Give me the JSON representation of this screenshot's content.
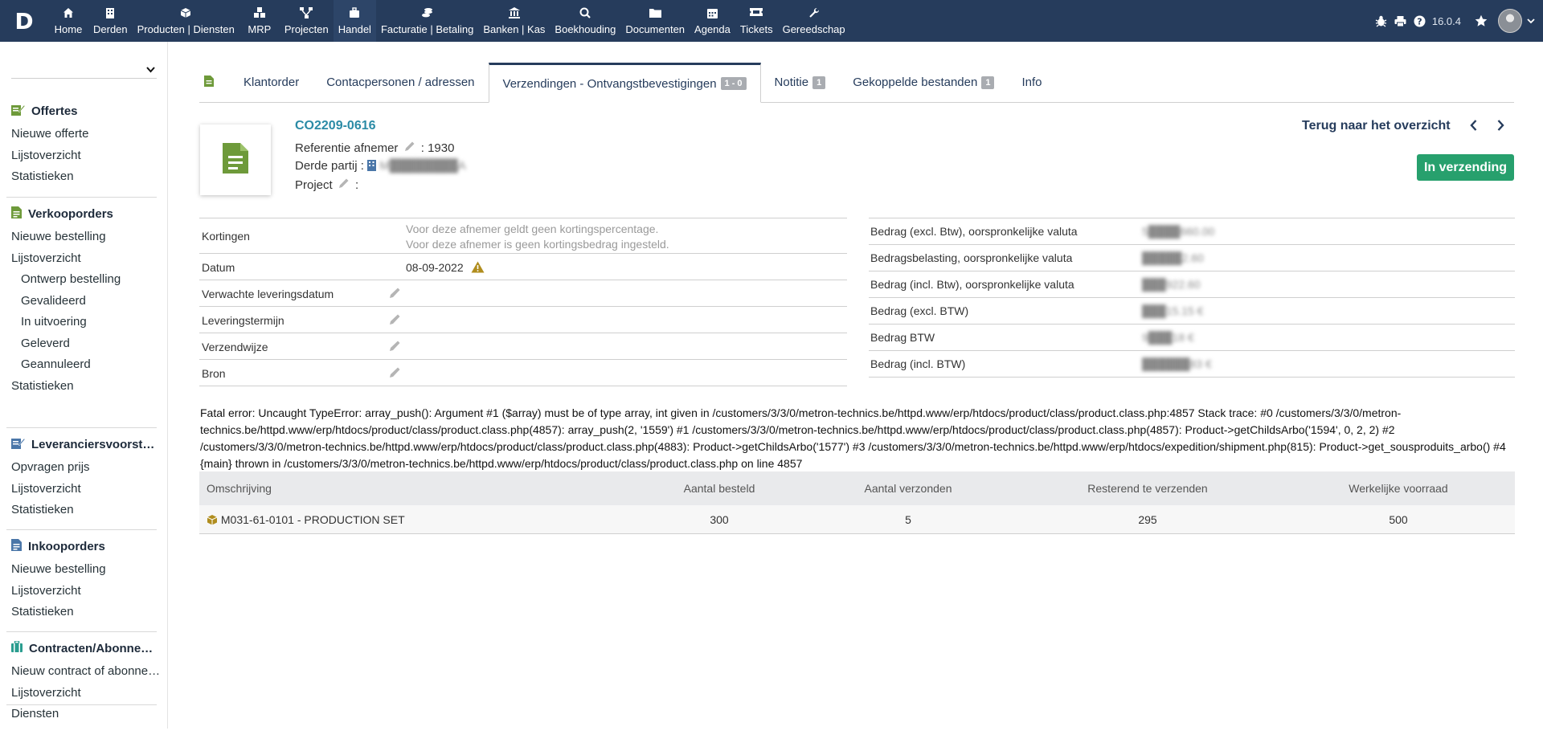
{
  "topnav": {
    "logo": "D",
    "items": [
      {
        "label": "Home",
        "icon": "home-icon"
      },
      {
        "label": "Derden",
        "icon": "building-icon"
      },
      {
        "label": "Producten | Diensten",
        "icon": "cube-icon"
      },
      {
        "label": "MRP",
        "icon": "cubes-icon"
      },
      {
        "label": "Projecten",
        "icon": "sitemap-icon"
      },
      {
        "label": "Handel",
        "icon": "briefcase-icon"
      },
      {
        "label": "Facturatie | Betaling",
        "icon": "coins-icon"
      },
      {
        "label": "Banken | Kas",
        "icon": "bank-icon"
      },
      {
        "label": "Boekhouding",
        "icon": "search-dollar-icon"
      },
      {
        "label": "Documenten",
        "icon": "folder-icon"
      },
      {
        "label": "Agenda",
        "icon": "calendar-icon"
      },
      {
        "label": "Tickets",
        "icon": "ticket-icon"
      },
      {
        "label": "Gereedschap",
        "icon": "wrench-icon"
      }
    ],
    "active": "Handel",
    "version": "16.0.4",
    "right_icons": [
      "bug-icon",
      "printer-icon",
      "help-icon",
      "star-icon",
      "avatar",
      "chevron-down-icon"
    ]
  },
  "sidebar": {
    "select_value": "",
    "sections": [
      {
        "title": "Offertes",
        "icon": "quote-icon",
        "color": "#6e9a3a",
        "links": [
          {
            "label": "Nieuwe offerte"
          },
          {
            "label": "Lijstoverzicht"
          },
          {
            "label": "Statistieken"
          }
        ]
      },
      {
        "title": "Verkooporders",
        "icon": "order-icon",
        "color": "#6e9a3a",
        "links": [
          {
            "label": "Nieuwe bestelling"
          },
          {
            "label": "Lijstoverzicht"
          },
          {
            "label": "Ontwerp bestelling",
            "sub": true
          },
          {
            "label": "Gevalideerd",
            "sub": true
          },
          {
            "label": "In uitvoering",
            "sub": true
          },
          {
            "label": "Geleverd",
            "sub": true
          },
          {
            "label": "Geannuleerd",
            "sub": true
          },
          {
            "label": "Statistieken"
          }
        ]
      },
      {
        "title": "Leveranciersvoorstellen",
        "icon": "supplier-quote-icon",
        "color": "#4a76a8",
        "links": [
          {
            "label": "Opvragen prijs"
          },
          {
            "label": "Lijstoverzicht"
          },
          {
            "label": "Statistieken"
          }
        ]
      },
      {
        "title": "Inkooporders",
        "icon": "purchase-icon",
        "color": "#4a76a8",
        "links": [
          {
            "label": "Nieuwe bestelling"
          },
          {
            "label": "Lijstoverzicht"
          },
          {
            "label": "Statistieken"
          }
        ]
      },
      {
        "title": "Contracten/Abonnementen",
        "icon": "contract-icon",
        "color": "#2a9d8f",
        "links": [
          {
            "label": "Nieuw contract of abonnement"
          },
          {
            "label": "Lijstoverzicht"
          },
          {
            "label": "Diensten"
          }
        ]
      }
    ]
  },
  "tabs": [
    {
      "label": "Klantorder"
    },
    {
      "label": "Contacpersonen / adressen"
    },
    {
      "label": "Verzendingen - Ontvangstbevestigingen",
      "badge": "1 - 0",
      "active": true
    },
    {
      "label": "Notitie",
      "badge": "1"
    },
    {
      "label": "Gekoppelde bestanden",
      "badge": "1"
    },
    {
      "label": "Info"
    }
  ],
  "header": {
    "ref": "CO2209-0616",
    "ref_afnemer_label": "Referentie afnemer",
    "ref_afnemer_value": ": 1930",
    "derde_label": "Derde partij :",
    "derde_value": "M████████A",
    "project_label": "Project",
    "project_value": ":",
    "back_label": "Terug naar het overzicht",
    "status_label": "In verzending",
    "status_color": "#27a06d"
  },
  "left_info": [
    {
      "label": "Kortingen",
      "value1": "Voor deze afnemer geldt geen kortingspercentage.",
      "value2": "Voor deze afnemer is geen kortingsbedrag ingesteld."
    },
    {
      "label": "Datum",
      "value": "08-09-2022",
      "warning": true
    },
    {
      "label": "Verwachte leveringsdatum",
      "editable": true
    },
    {
      "label": "Leveringstermijn",
      "editable": true
    },
    {
      "label": "Verzendwijze",
      "editable": true
    },
    {
      "label": "Bron",
      "editable": true
    }
  ],
  "right_info": [
    {
      "label": "Bedrag (excl. Btw), oorspronkelijke valuta",
      "value": "5████660.00"
    },
    {
      "label": "Bedragsbelasting, oorspronkelijke valuta",
      "value": "█████2.60"
    },
    {
      "label": "Bedrag (incl. Btw), oorspronkelijke valuta",
      "value": "███922.60"
    },
    {
      "label": "Bedrag (excl. BTW)",
      "value": "███15.15 €"
    },
    {
      "label": "Bedrag BTW",
      "value": "9███18 €"
    },
    {
      "label": "Bedrag (incl. BTW)",
      "value": "██████83 €"
    }
  ],
  "error": "Fatal error: Uncaught TypeError: array_push(): Argument #1 ($array) must be of type array, int given in /customers/3/3/0/metron-technics.be/httpd.www/erp/htdocs/product/class/product.class.php:4857 Stack trace: #0 /customers/3/3/0/metron-technics.be/httpd.www/erp/htdocs/product/class/product.class.php(4857): array_push(2, '1559') #1 /customers/3/3/0/metron-technics.be/httpd.www/erp/htdocs/product/class/product.class.php(4857): Product->getChildsArbo('1594', 0, 2, 2) #2 /customers/3/3/0/metron-technics.be/httpd.www/erp/htdocs/product/class/product.class.php(4883): Product->getChildsArbo('1577') #3 /customers/3/3/0/metron-technics.be/httpd.www/erp/htdocs/expedition/shipment.php(815): Product->get_sousproduits_arbo() #4 {main} thrown in /customers/3/3/0/metron-technics.be/httpd.www/erp/htdocs/product/class/product.class.php on line 4857",
  "products": {
    "columns": [
      "Omschrijving",
      "Aantal besteld",
      "Aantal verzonden",
      "Resterend te verzenden",
      "Werkelijke voorraad"
    ],
    "rows": [
      {
        "omschrijving": "M031-61-0101 - PRODUCTION SET",
        "besteld": "300",
        "verzonden": "5",
        "resterend": "295",
        "voorraad": "500"
      }
    ]
  }
}
